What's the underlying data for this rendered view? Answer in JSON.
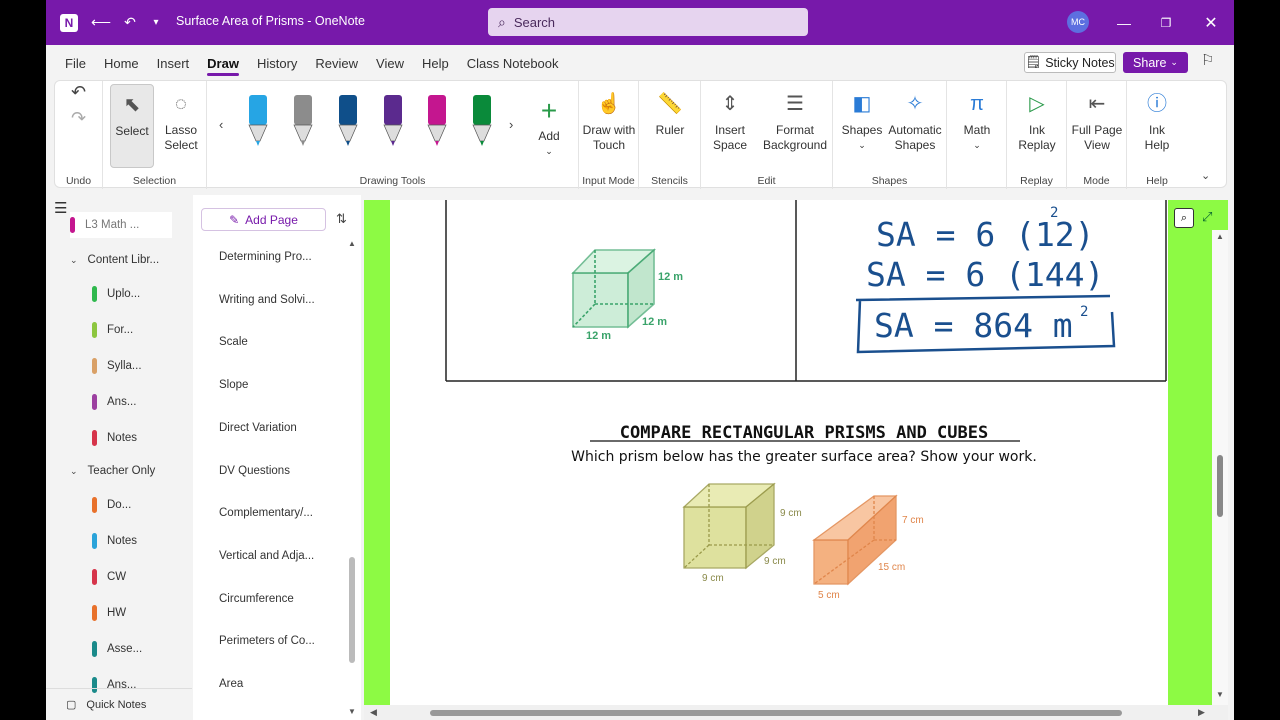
{
  "titlebar": {
    "title": "Surface Area of Prisms  -  OneNote",
    "search_placeholder": "Search",
    "avatar_initials": "MC",
    "app_icon": "onenote-logo-icon"
  },
  "tabs": [
    "File",
    "Home",
    "Insert",
    "Draw",
    "History",
    "Review",
    "View",
    "Help",
    "Class Notebook"
  ],
  "active_tab": "Draw",
  "top_right": {
    "sticky_notes": "Sticky Notes",
    "share": "Share"
  },
  "ribbon": {
    "undo_group": "Undo",
    "selection": {
      "select": "Select",
      "lasso1": "Lasso",
      "lasso2": "Select",
      "group": "Selection"
    },
    "drawing_tools": {
      "group": "Drawing Tools",
      "add": "Add",
      "pen_colors": [
        "#26a5e4",
        "#8c8c8c",
        "#0f4f8a",
        "#5b2a8e",
        "#c4168f",
        "#0a8a3a"
      ]
    },
    "input_mode": {
      "l1": "Draw with",
      "l2": "Touch",
      "group": "Input Mode"
    },
    "stencils": {
      "ruler": "Ruler",
      "group": "Stencils"
    },
    "edit": {
      "insert1": "Insert",
      "insert2": "Space",
      "format1": "Format",
      "format2": "Background",
      "group": "Edit"
    },
    "shapes": {
      "shapes": "Shapes",
      "auto1": "Automatic",
      "auto2": "Shapes",
      "group": "Shapes"
    },
    "math": {
      "label": "Math"
    },
    "replay": {
      "l1": "Ink",
      "l2": "Replay",
      "group": "Replay"
    },
    "mode": {
      "l1": "Full Page",
      "l2": "View",
      "group": "Mode"
    },
    "help": {
      "l1": "Ink",
      "l2": "Help",
      "group": "Help"
    }
  },
  "nav": {
    "top_item": "L3 Math ...",
    "sections": [
      {
        "label": "Content Libr...",
        "type": "group"
      },
      {
        "label": "Uplo...",
        "color": "#2fb84d"
      },
      {
        "label": "For...",
        "color": "#8cc63f"
      },
      {
        "label": "Sylla...",
        "color": "#d9a066"
      },
      {
        "label": "Ans...",
        "color": "#9c3fa0"
      },
      {
        "label": "Notes",
        "color": "#d6344a"
      },
      {
        "label": "Teacher Only",
        "type": "group"
      },
      {
        "label": "Do...",
        "color": "#e8712b"
      },
      {
        "label": "Notes",
        "color": "#2aa3d9"
      },
      {
        "label": "CW",
        "color": "#d6344a"
      },
      {
        "label": "HW",
        "color": "#e8712b"
      },
      {
        "label": "Asse...",
        "color": "#1a8a8a"
      },
      {
        "label": "Ans...",
        "color": "#1a8a8a"
      }
    ],
    "quick_notes": "Quick Notes"
  },
  "pages": {
    "add_page": "Add Page",
    "items": [
      "Determining Pro...",
      "Writing and Solvi...",
      "Scale",
      "Slope",
      "Direct Variation",
      "DV Questions",
      "Complementary/...",
      "Vertical and Adja...",
      "Circumference",
      "Perimeters of Co...",
      "Area"
    ]
  },
  "note": {
    "cube1": {
      "h": "12 m",
      "d": "12 m",
      "w": "12 m"
    },
    "ink": {
      "line1": "SA = 6 (12)",
      "exp1": "2",
      "line2": "SA = 6 (144)",
      "line3": "SA = 864 m",
      "exp3": "2"
    },
    "heading": "COMPARE RECTANGULAR PRISMS AND CUBES",
    "subheading": "Which prism below has the greater surface area? Show your work.",
    "cube2": {
      "h": "9 cm",
      "d": "9 cm",
      "w": "9 cm",
      "color": "#d9dc8e"
    },
    "prism": {
      "h": "7 cm",
      "d": "15 cm",
      "w": "5 cm",
      "color": "#f3a46b"
    }
  }
}
